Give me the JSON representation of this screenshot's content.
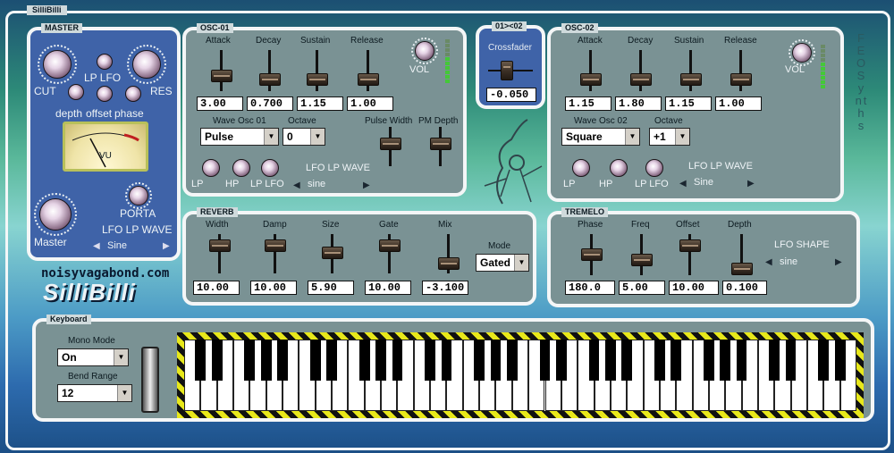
{
  "app": {
    "title": "SilliBilli"
  },
  "master": {
    "label": "MASTER",
    "knobs": {
      "cut": "CUT",
      "lp_lfo": "LP LFO",
      "res": "RES",
      "depth": "depth",
      "offset": "offset",
      "phase": "phase",
      "master": "Master",
      "porta": "PORTA"
    },
    "vu_label": "VU",
    "lfo_label": "LFO LP WAVE",
    "lfo_value": "Sine"
  },
  "branding": {
    "url": "noisyvagabond.com",
    "name": "SilliBilli",
    "vertical": "FEO Synths"
  },
  "osc1": {
    "label": "OSC-01",
    "adsr_labels": [
      "Attack",
      "Decay",
      "Sustain",
      "Release"
    ],
    "adsr_values": [
      "3.00",
      "0.700",
      "1.15",
      "1.00"
    ],
    "vol_label": "VOL",
    "wave_label": "Wave Osc 01",
    "wave_value": "Pulse",
    "octave_label": "Octave",
    "octave_value": "0",
    "pw_label": "Pulse Width",
    "pm_label": "PM Depth",
    "knob_labels": [
      "LP",
      "HP",
      "LP LFO"
    ],
    "lfo_label": "LFO LP WAVE",
    "lfo_value": "sine"
  },
  "crossfader": {
    "label": "01><02",
    "title": "Crossfader",
    "value": "-0.050"
  },
  "osc2": {
    "label": "OSC-02",
    "adsr_labels": [
      "Attack",
      "Decay",
      "Sustain",
      "Release"
    ],
    "adsr_values": [
      "1.15",
      "1.80",
      "1.15",
      "1.00"
    ],
    "vol_label": "VOL",
    "wave_label": "Wave Osc 02",
    "wave_value": "Square",
    "octave_label": "Octave",
    "octave_value": "+1",
    "knob_labels": [
      "LP",
      "HP",
      "LP LFO"
    ],
    "lfo_label": "LFO LP WAVE",
    "lfo_value": "Sine"
  },
  "reverb": {
    "label": "REVERB",
    "slider_labels": [
      "Width",
      "Damp",
      "Size",
      "Gate",
      "Mix"
    ],
    "slider_values": [
      "10.00",
      "10.00",
      "5.90",
      "10.00",
      "-3.100"
    ],
    "mode_label": "Mode",
    "mode_value": "Gated"
  },
  "tremelo": {
    "label": "TREMELO",
    "slider_labels": [
      "Phase",
      "Freq",
      "Offset",
      "Depth"
    ],
    "slider_values": [
      "180.0",
      "5.00",
      "10.00",
      "0.100"
    ],
    "lfo_shape_label": "LFO SHAPE",
    "lfo_shape_value": "sine"
  },
  "keyboard": {
    "label": "Keyboard",
    "mono_label": "Mono Mode",
    "mono_value": "On",
    "bend_label": "Bend Range",
    "bend_value": "12"
  },
  "colors": {
    "panel": "#7a9294",
    "master_bg": "#3f63a8",
    "vu_green": "#44c838",
    "hazard_yellow": "#e8e81a"
  }
}
